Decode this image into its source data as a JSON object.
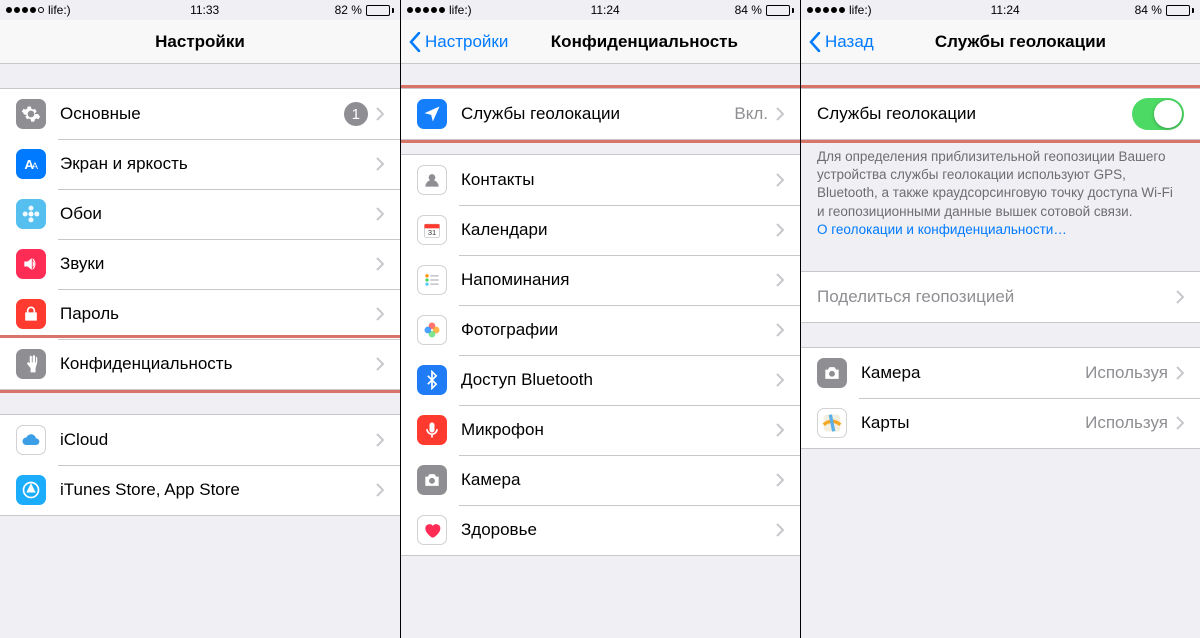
{
  "phones": [
    {
      "status": {
        "carrier": "life:)",
        "time": "11:33",
        "battery_pct": "82 %",
        "signal_filled": 4,
        "batt_fill_pct": 82
      },
      "nav": {
        "title": "Настройки",
        "back": null
      },
      "groups": [
        {
          "cells": [
            {
              "key": "general",
              "label": "Основные",
              "badge": "1",
              "icon": "gear",
              "icon_bg": "ic-gray"
            },
            {
              "key": "display",
              "label": "Экран и яркость",
              "icon": "textformat",
              "icon_bg": "ic-blue"
            },
            {
              "key": "wallpaper",
              "label": "Обои",
              "icon": "flower",
              "icon_bg": "ic-ltblue"
            },
            {
              "key": "sounds",
              "label": "Звуки",
              "icon": "speaker",
              "icon_bg": "ic-pink"
            },
            {
              "key": "passcode",
              "label": "Пароль",
              "icon": "lock",
              "icon_bg": "ic-red"
            },
            {
              "key": "privacy",
              "label": "Конфиденциальность",
              "icon": "hand",
              "icon_bg": "ic-gray",
              "highlight": true
            }
          ]
        },
        {
          "cells": [
            {
              "key": "icloud",
              "label": "iCloud",
              "icon": "cloud",
              "icon_bg": "ic-white"
            },
            {
              "key": "itunes",
              "label": "iTunes Store, App Store",
              "icon": "appstore",
              "icon_bg": "ic-appstore"
            }
          ]
        }
      ]
    },
    {
      "status": {
        "carrier": "life:)",
        "time": "11:24",
        "battery_pct": "84 %",
        "signal_filled": 5,
        "batt_fill_pct": 84
      },
      "nav": {
        "title": "Конфиденциальность",
        "back": "Настройки"
      },
      "groups": [
        {
          "cells": [
            {
              "key": "location",
              "label": "Службы геолокации",
              "detail": "Вкл.",
              "icon": "location",
              "icon_bg": "ic-loc",
              "highlight": true
            }
          ]
        },
        {
          "cells": [
            {
              "key": "contacts",
              "label": "Контакты",
              "icon": "contacts",
              "icon_bg": "ic-white"
            },
            {
              "key": "calendars",
              "label": "Календари",
              "icon": "calendar",
              "icon_bg": "ic-white"
            },
            {
              "key": "reminders",
              "label": "Напоминания",
              "icon": "reminders",
              "icon_bg": "ic-white"
            },
            {
              "key": "photos",
              "label": "Фотографии",
              "icon": "photos",
              "icon_bg": "ic-multi"
            },
            {
              "key": "bluetooth",
              "label": "Доступ Bluetooth",
              "icon": "bluetooth",
              "icon_bg": "ic-bluetooth"
            },
            {
              "key": "microphone",
              "label": "Микрофон",
              "icon": "mic",
              "icon_bg": "ic-red"
            },
            {
              "key": "camera",
              "label": "Камера",
              "icon": "camera",
              "icon_bg": "ic-gray"
            },
            {
              "key": "health",
              "label": "Здоровье",
              "icon": "heart",
              "icon_bg": "ic-white"
            }
          ]
        }
      ]
    },
    {
      "status": {
        "carrier": "life:)",
        "time": "11:24",
        "battery_pct": "84 %",
        "signal_filled": 5,
        "batt_fill_pct": 84
      },
      "nav": {
        "title": "Службы геолокации",
        "back": "Назад"
      },
      "toggle_row": {
        "label": "Службы геолокации",
        "on": true,
        "highlight": true
      },
      "footer": {
        "text": "Для определения приблизительной геопозиции Вашего устройства службы геолокации используют GPS, Bluetooth, а также краудсорсинговую точку доступа Wi-Fi и геопозиционными данные вышек сотовой связи.",
        "link": "О геолокации и конфиденциальности…"
      },
      "groups": [
        {
          "cells": [
            {
              "key": "share",
              "label": "Поделиться геопозицией",
              "no_icon": true
            }
          ]
        },
        {
          "cells": [
            {
              "key": "camera-app",
              "label": "Камера",
              "detail": "Используя",
              "icon": "camera",
              "icon_bg": "ic-gray"
            },
            {
              "key": "maps-app",
              "label": "Карты",
              "detail": "Используя",
              "icon": "maps",
              "icon_bg": "ic-white"
            }
          ]
        }
      ]
    }
  ]
}
